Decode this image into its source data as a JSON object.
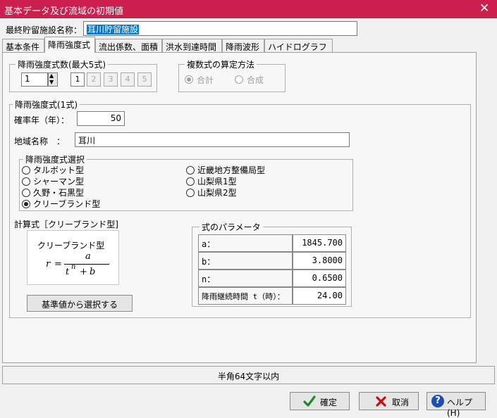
{
  "window": {
    "title": "基本データ及び流域の初期値",
    "close_label": "✕"
  },
  "facility": {
    "label": "最終貯留施設名称：",
    "value": "耳川貯留施設"
  },
  "tabs": [
    {
      "label": "基本条件"
    },
    {
      "label": "降雨強度式"
    },
    {
      "label": "流出係数、面積"
    },
    {
      "label": "洪水到達時間"
    },
    {
      "label": "降雨波形"
    },
    {
      "label": "ハイドログラフ"
    }
  ],
  "formula_count": {
    "label": "降雨強度式数(最大5式)",
    "value": "1",
    "buttons": [
      "1",
      "2",
      "3",
      "4",
      "5"
    ]
  },
  "combine": {
    "label": "複数式の算定方法",
    "options": [
      {
        "label": "合計"
      },
      {
        "label": "合成"
      }
    ]
  },
  "formula": {
    "group_label": "降雨強度式(1式)",
    "return_period_label": "確率年（年）：",
    "return_period_value": "50",
    "region_label": "地域名称　：",
    "region_value": "耳川",
    "select_label": "降雨強度式選択",
    "options": [
      {
        "label": "タルボット型"
      },
      {
        "label": "シャーマン型"
      },
      {
        "label": "久野・石黒型"
      },
      {
        "label": "クリーブランド型"
      },
      {
        "label": "近畿地方整備局型"
      },
      {
        "label": "山梨県1型"
      },
      {
        "label": "山梨県2型"
      }
    ],
    "calc_label": "計算式［クリーブランド型]",
    "formula_box_title": "クリーブランド型",
    "eq": {
      "r": "r",
      "eq": "=",
      "num": "a",
      "t": "t",
      "n": "n",
      "plus": "+",
      "b": "b"
    },
    "select_button": "基準値から選択する",
    "params_label": "式のパラメータ",
    "params": [
      {
        "name": "a：",
        "value": "1845.700"
      },
      {
        "name": "b：",
        "value": "3.8000"
      },
      {
        "name": "n：",
        "value": "0.6500"
      },
      {
        "name": "降雨継続時間 t（時）：",
        "value": "24.00"
      }
    ]
  },
  "status": {
    "text": "半角64文字以内"
  },
  "footer": {
    "ok_label": "確定",
    "cancel_label": "取消",
    "help_label": "ヘルプ(H)"
  },
  "colors": {
    "title_bar": "#cc1f4e",
    "ok_icon": "#1e8a1e",
    "cancel_icon": "#c01010",
    "help_icon": "#1c4fb0"
  }
}
